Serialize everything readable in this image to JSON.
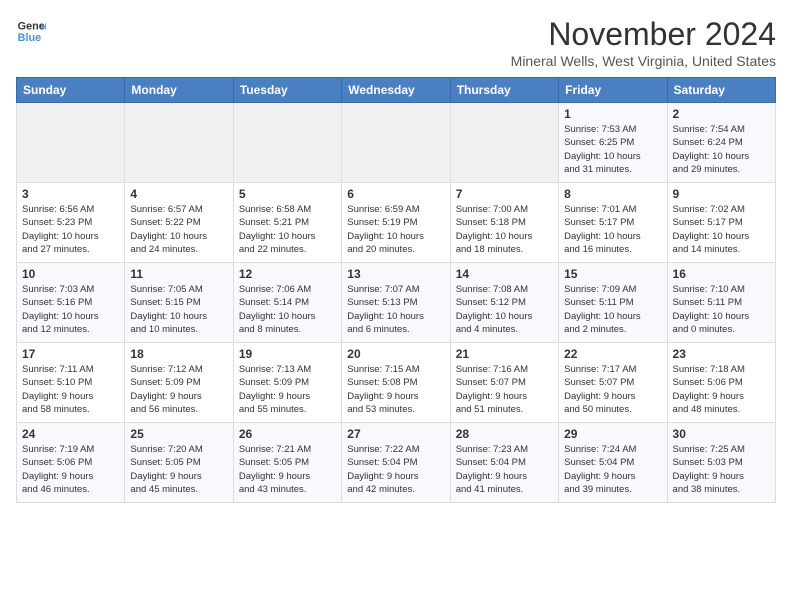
{
  "logo": {
    "line1": "General",
    "line2": "Blue"
  },
  "title": "November 2024",
  "location": "Mineral Wells, West Virginia, United States",
  "weekdays": [
    "Sunday",
    "Monday",
    "Tuesday",
    "Wednesday",
    "Thursday",
    "Friday",
    "Saturday"
  ],
  "weeks": [
    [
      {
        "day": "",
        "info": ""
      },
      {
        "day": "",
        "info": ""
      },
      {
        "day": "",
        "info": ""
      },
      {
        "day": "",
        "info": ""
      },
      {
        "day": "",
        "info": ""
      },
      {
        "day": "1",
        "info": "Sunrise: 7:53 AM\nSunset: 6:25 PM\nDaylight: 10 hours\nand 31 minutes."
      },
      {
        "day": "2",
        "info": "Sunrise: 7:54 AM\nSunset: 6:24 PM\nDaylight: 10 hours\nand 29 minutes."
      }
    ],
    [
      {
        "day": "3",
        "info": "Sunrise: 6:56 AM\nSunset: 5:23 PM\nDaylight: 10 hours\nand 27 minutes."
      },
      {
        "day": "4",
        "info": "Sunrise: 6:57 AM\nSunset: 5:22 PM\nDaylight: 10 hours\nand 24 minutes."
      },
      {
        "day": "5",
        "info": "Sunrise: 6:58 AM\nSunset: 5:21 PM\nDaylight: 10 hours\nand 22 minutes."
      },
      {
        "day": "6",
        "info": "Sunrise: 6:59 AM\nSunset: 5:19 PM\nDaylight: 10 hours\nand 20 minutes."
      },
      {
        "day": "7",
        "info": "Sunrise: 7:00 AM\nSunset: 5:18 PM\nDaylight: 10 hours\nand 18 minutes."
      },
      {
        "day": "8",
        "info": "Sunrise: 7:01 AM\nSunset: 5:17 PM\nDaylight: 10 hours\nand 16 minutes."
      },
      {
        "day": "9",
        "info": "Sunrise: 7:02 AM\nSunset: 5:17 PM\nDaylight: 10 hours\nand 14 minutes."
      }
    ],
    [
      {
        "day": "10",
        "info": "Sunrise: 7:03 AM\nSunset: 5:16 PM\nDaylight: 10 hours\nand 12 minutes."
      },
      {
        "day": "11",
        "info": "Sunrise: 7:05 AM\nSunset: 5:15 PM\nDaylight: 10 hours\nand 10 minutes."
      },
      {
        "day": "12",
        "info": "Sunrise: 7:06 AM\nSunset: 5:14 PM\nDaylight: 10 hours\nand 8 minutes."
      },
      {
        "day": "13",
        "info": "Sunrise: 7:07 AM\nSunset: 5:13 PM\nDaylight: 10 hours\nand 6 minutes."
      },
      {
        "day": "14",
        "info": "Sunrise: 7:08 AM\nSunset: 5:12 PM\nDaylight: 10 hours\nand 4 minutes."
      },
      {
        "day": "15",
        "info": "Sunrise: 7:09 AM\nSunset: 5:11 PM\nDaylight: 10 hours\nand 2 minutes."
      },
      {
        "day": "16",
        "info": "Sunrise: 7:10 AM\nSunset: 5:11 PM\nDaylight: 10 hours\nand 0 minutes."
      }
    ],
    [
      {
        "day": "17",
        "info": "Sunrise: 7:11 AM\nSunset: 5:10 PM\nDaylight: 9 hours\nand 58 minutes."
      },
      {
        "day": "18",
        "info": "Sunrise: 7:12 AM\nSunset: 5:09 PM\nDaylight: 9 hours\nand 56 minutes."
      },
      {
        "day": "19",
        "info": "Sunrise: 7:13 AM\nSunset: 5:09 PM\nDaylight: 9 hours\nand 55 minutes."
      },
      {
        "day": "20",
        "info": "Sunrise: 7:15 AM\nSunset: 5:08 PM\nDaylight: 9 hours\nand 53 minutes."
      },
      {
        "day": "21",
        "info": "Sunrise: 7:16 AM\nSunset: 5:07 PM\nDaylight: 9 hours\nand 51 minutes."
      },
      {
        "day": "22",
        "info": "Sunrise: 7:17 AM\nSunset: 5:07 PM\nDaylight: 9 hours\nand 50 minutes."
      },
      {
        "day": "23",
        "info": "Sunrise: 7:18 AM\nSunset: 5:06 PM\nDaylight: 9 hours\nand 48 minutes."
      }
    ],
    [
      {
        "day": "24",
        "info": "Sunrise: 7:19 AM\nSunset: 5:06 PM\nDaylight: 9 hours\nand 46 minutes."
      },
      {
        "day": "25",
        "info": "Sunrise: 7:20 AM\nSunset: 5:05 PM\nDaylight: 9 hours\nand 45 minutes."
      },
      {
        "day": "26",
        "info": "Sunrise: 7:21 AM\nSunset: 5:05 PM\nDaylight: 9 hours\nand 43 minutes."
      },
      {
        "day": "27",
        "info": "Sunrise: 7:22 AM\nSunset: 5:04 PM\nDaylight: 9 hours\nand 42 minutes."
      },
      {
        "day": "28",
        "info": "Sunrise: 7:23 AM\nSunset: 5:04 PM\nDaylight: 9 hours\nand 41 minutes."
      },
      {
        "day": "29",
        "info": "Sunrise: 7:24 AM\nSunset: 5:04 PM\nDaylight: 9 hours\nand 39 minutes."
      },
      {
        "day": "30",
        "info": "Sunrise: 7:25 AM\nSunset: 5:03 PM\nDaylight: 9 hours\nand 38 minutes."
      }
    ]
  ]
}
